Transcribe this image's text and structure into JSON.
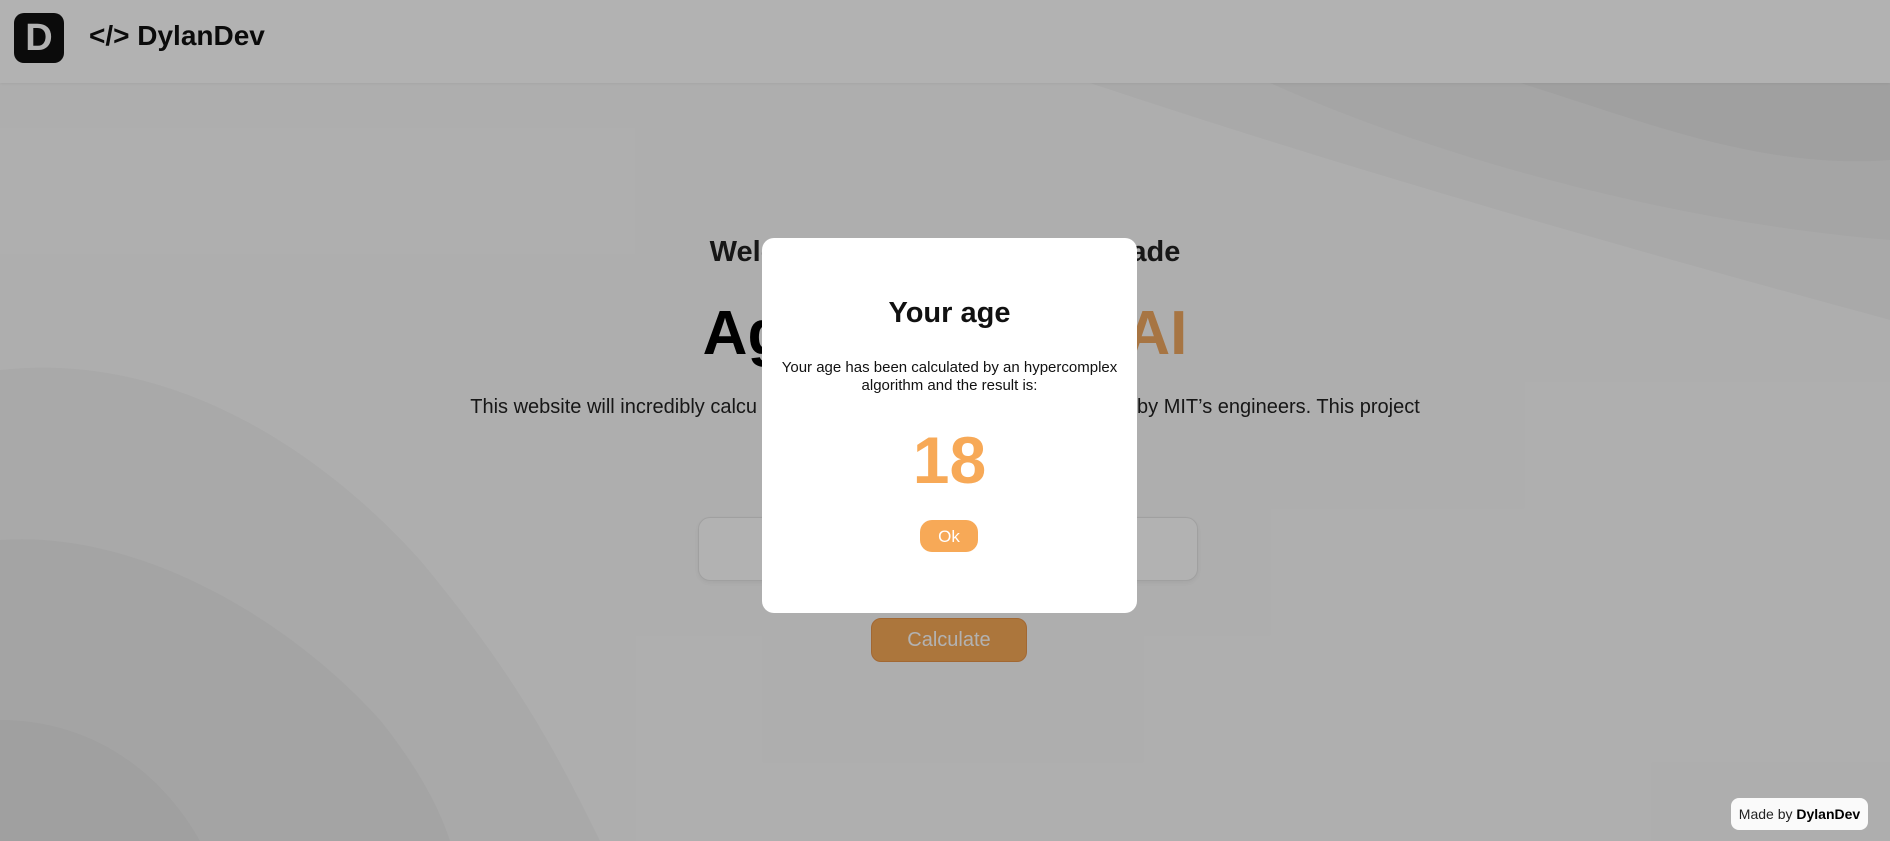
{
  "header": {
    "logo_letter": "D",
    "brand": "</> DylanDev"
  },
  "hero": {
    "welcome_left": "Welco",
    "welcome_right": "made",
    "title_left": "Ag",
    "title_accent": "AI",
    "description_left": "This website will incredibly calcu",
    "description_right": "by MIT’s engineers. This project"
  },
  "form": {
    "input_value": "",
    "calculate_label": "Calculate"
  },
  "modal": {
    "title": "Your age",
    "text": "Your age has been calculated by an hypercomplex algorithm and the result is:",
    "age": "18",
    "ok_label": "Ok"
  },
  "footer": {
    "made_by_prefix": "Made by",
    "made_by_name": "DylanDev"
  },
  "colors": {
    "accent": "#f7a957",
    "overlay": "rgba(0,0,0,0.30)"
  }
}
